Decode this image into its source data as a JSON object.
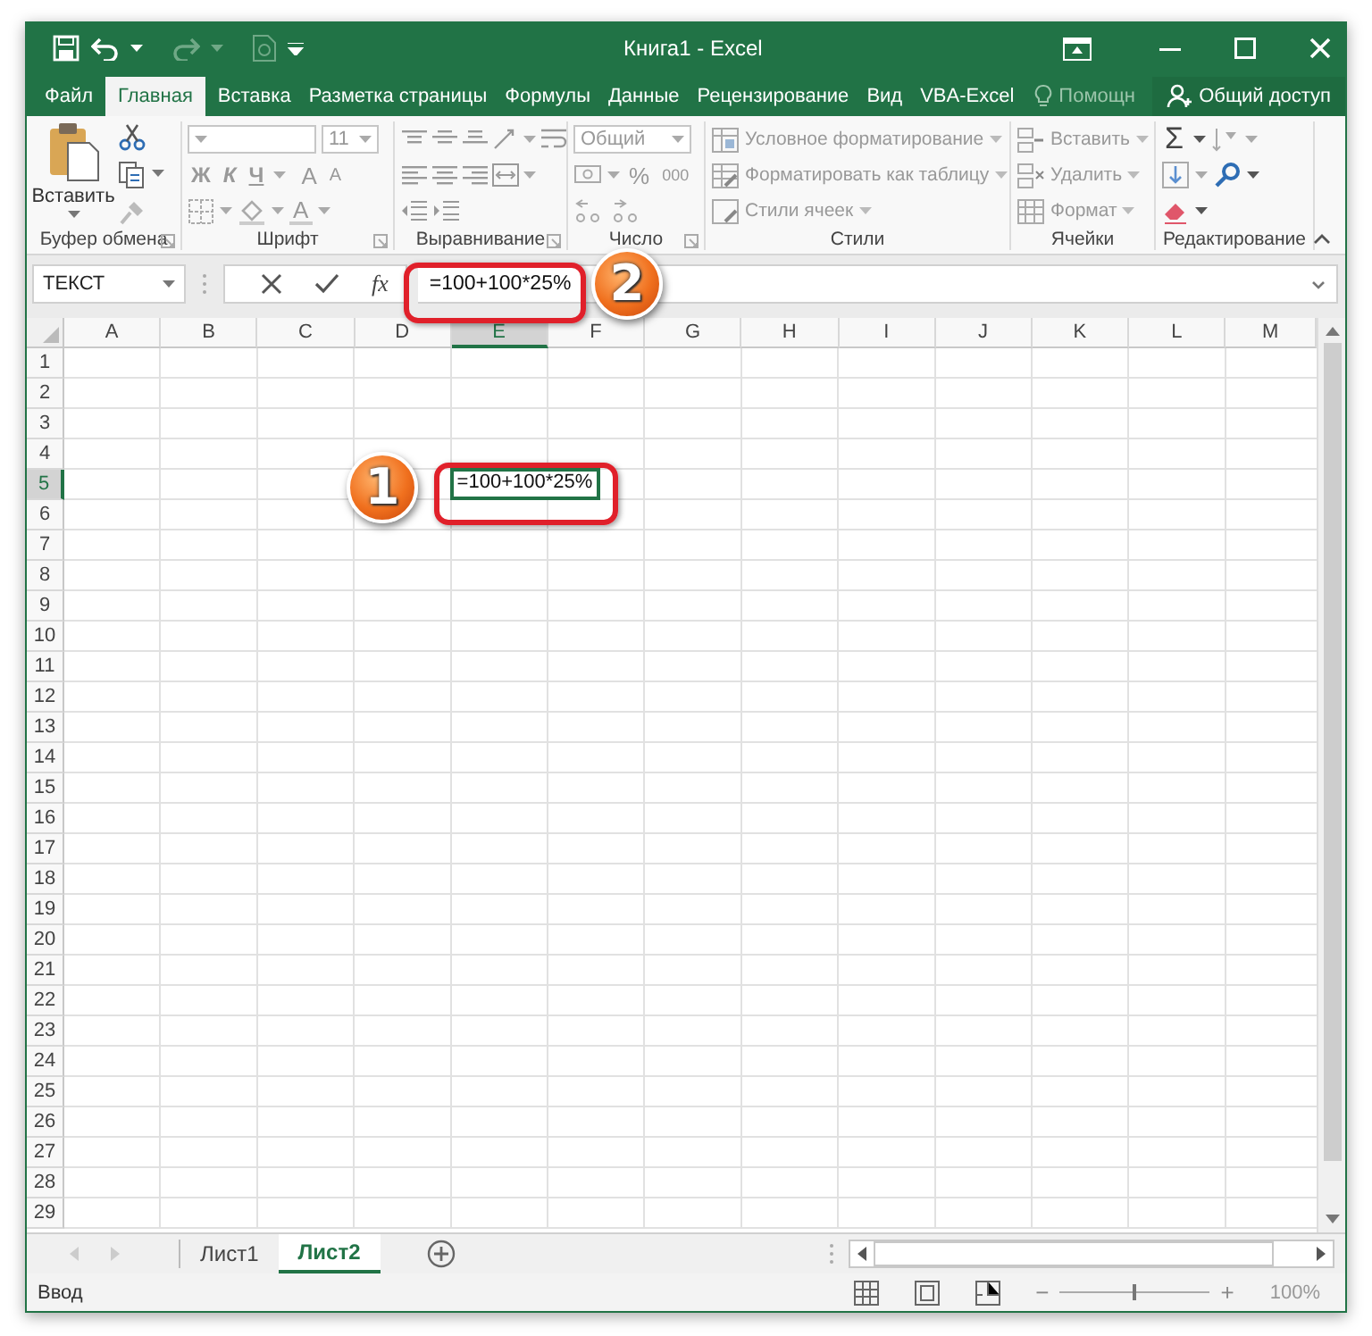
{
  "window": {
    "title": "Книга1 - Excel"
  },
  "ribbon_tabs": [
    {
      "label": "Файл",
      "selected": false
    },
    {
      "label": "Главная",
      "selected": true
    },
    {
      "label": "Вставка",
      "selected": false
    },
    {
      "label": "Разметка страницы",
      "selected": false
    },
    {
      "label": "Формулы",
      "selected": false
    },
    {
      "label": "Данные",
      "selected": false
    },
    {
      "label": "Рецензирование",
      "selected": false
    },
    {
      "label": "Вид",
      "selected": false
    },
    {
      "label": "VBA-Excel",
      "selected": false
    }
  ],
  "tell_me": {
    "placeholder": "Помощн"
  },
  "share_button": {
    "label": "Общий доступ"
  },
  "ribbon_groups": [
    {
      "kind": "clipboard",
      "label": "Буфер обмена",
      "launcher": true,
      "paste": "Вставить"
    },
    {
      "kind": "font",
      "label": "Шрифт",
      "launcher": true,
      "font_size": "11",
      "bold": "Ж",
      "italic": "К",
      "underline": "Ч",
      "grow": "A",
      "shrink": "A",
      "font_color": "A"
    },
    {
      "kind": "alignment",
      "label": "Выравнивание",
      "launcher": true
    },
    {
      "kind": "number",
      "label": "Число",
      "launcher": true,
      "format": "Общий",
      "percent": "%",
      "thousands": "000"
    },
    {
      "kind": "styles",
      "label": "Стили",
      "launcher": false,
      "items": [
        "Условное форматирование",
        "Форматировать как таблицу",
        "Стили ячеек"
      ]
    },
    {
      "kind": "cells",
      "label": "Ячейки",
      "launcher": false,
      "items": [
        "Вставить",
        "Удалить",
        "Формат"
      ]
    },
    {
      "kind": "editing",
      "label": "Редактирование",
      "launcher": false,
      "sum": "Σ"
    }
  ],
  "formula_bar": {
    "name_box": "ТЕКСТ",
    "fx": "fx",
    "formula": "=100+100*25%"
  },
  "sheet": {
    "columns": [
      {
        "label": "A",
        "selected": false
      },
      {
        "label": "B",
        "selected": false
      },
      {
        "label": "C",
        "selected": false
      },
      {
        "label": "D",
        "selected": false
      },
      {
        "label": "E",
        "selected": true
      },
      {
        "label": "F",
        "selected": false
      },
      {
        "label": "G",
        "selected": false
      },
      {
        "label": "H",
        "selected": false
      },
      {
        "label": "I",
        "selected": false
      },
      {
        "label": "J",
        "selected": false
      },
      {
        "label": "K",
        "selected": false
      },
      {
        "label": "L",
        "selected": false
      },
      {
        "label": "M",
        "selected": false
      }
    ],
    "rows": [
      {
        "label": "1",
        "selected": false
      },
      {
        "label": "2",
        "selected": false
      },
      {
        "label": "3",
        "selected": false
      },
      {
        "label": "4",
        "selected": false
      },
      {
        "label": "5",
        "selected": true
      },
      {
        "label": "6",
        "selected": false
      },
      {
        "label": "7",
        "selected": false
      },
      {
        "label": "8",
        "selected": false
      },
      {
        "label": "9",
        "selected": false
      },
      {
        "label": "10",
        "selected": false
      },
      {
        "label": "11",
        "selected": false
      },
      {
        "label": "12",
        "selected": false
      },
      {
        "label": "13",
        "selected": false
      },
      {
        "label": "14",
        "selected": false
      },
      {
        "label": "15",
        "selected": false
      },
      {
        "label": "16",
        "selected": false
      },
      {
        "label": "17",
        "selected": false
      },
      {
        "label": "18",
        "selected": false
      },
      {
        "label": "19",
        "selected": false
      },
      {
        "label": "20",
        "selected": false
      },
      {
        "label": "21",
        "selected": false
      },
      {
        "label": "22",
        "selected": false
      },
      {
        "label": "23",
        "selected": false
      },
      {
        "label": "24",
        "selected": false
      },
      {
        "label": "25",
        "selected": false
      },
      {
        "label": "26",
        "selected": false
      },
      {
        "label": "27",
        "selected": false
      },
      {
        "label": "28",
        "selected": false
      },
      {
        "label": "29",
        "selected": false
      }
    ],
    "active_cell": {
      "value": "=100+100*25%"
    }
  },
  "sheet_tabs": [
    {
      "label": "Лист1",
      "selected": false
    },
    {
      "label": "Лист2",
      "selected": true
    }
  ],
  "status_bar": {
    "mode": "Ввод",
    "zoom_out": "−",
    "zoom_in": "+",
    "zoom": "100%",
    "level": 0.5
  },
  "callouts": [
    {
      "label": "1"
    },
    {
      "label": "2"
    }
  ]
}
